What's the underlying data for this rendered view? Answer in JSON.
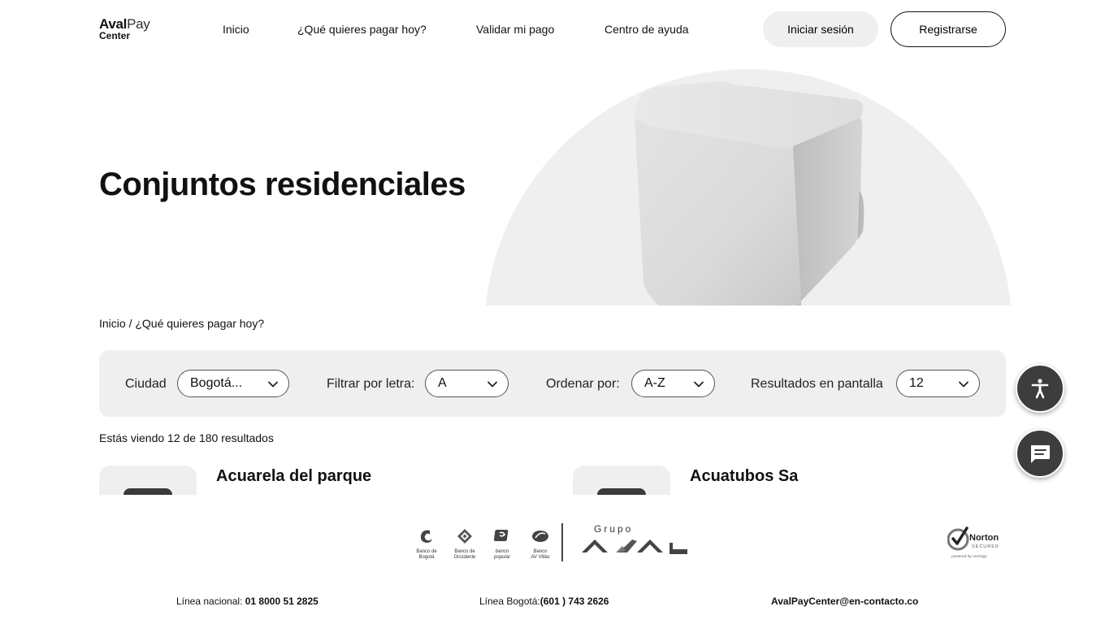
{
  "logo": {
    "line1_bold": "Aval",
    "line1_light": "Pay",
    "line2": "Center"
  },
  "nav": {
    "items": [
      {
        "label": "Inicio"
      },
      {
        "label": "¿Qué quieres pagar hoy?"
      },
      {
        "label": "Validar mi pago"
      },
      {
        "label": "Centro de ayuda"
      }
    ],
    "login_label": "Iniciar sesión",
    "register_label": "Registrarse"
  },
  "hero": {
    "title": "Conjuntos residenciales"
  },
  "breadcrumb": {
    "home": "Inicio",
    "separator": " / ",
    "current": "¿Qué quieres pagar hoy?"
  },
  "filters": {
    "city": {
      "label": "Ciudad",
      "value": "Bogotá..."
    },
    "letter": {
      "label": "Filtrar por letra:",
      "value": "A"
    },
    "sort": {
      "label": "Ordenar por:",
      "value": "A-Z"
    },
    "per_page": {
      "label": "Resultados en pantalla",
      "value": "12"
    }
  },
  "results": {
    "text": "Estás viendo 12 de 180 resultados"
  },
  "cards": [
    {
      "title": "Acuarela del parque"
    },
    {
      "title": "Acuatubos Sa"
    }
  ],
  "floating": {
    "accessibility_icon": "accessibility-icon",
    "chat_icon": "chat-icon"
  },
  "footer": {
    "banks": [
      {
        "name_line1": "Banco de",
        "name_line2": "Bogotá"
      },
      {
        "name_line1": "Banco de",
        "name_line2": "Occidente"
      },
      {
        "name_line1": "banco",
        "name_line2": "popular"
      },
      {
        "name_line1": "Banco",
        "name_line2": "AV Villas"
      }
    ],
    "grupo": "Grupo",
    "norton": {
      "name": "Norton",
      "sub": "SECURED",
      "powered": "powered by VeriSign"
    },
    "national_line": {
      "label": "Línea nacional: ",
      "value": "01 8000 51 2825"
    },
    "bogota_line": {
      "label": "Línea Bogotá:",
      "value": "(601 ) 743 2626"
    },
    "email": "AvalPayCenter@en-contacto.co"
  },
  "colors": {
    "accent_dark": "#3d3d3d",
    "panel_bg": "#efefef"
  }
}
